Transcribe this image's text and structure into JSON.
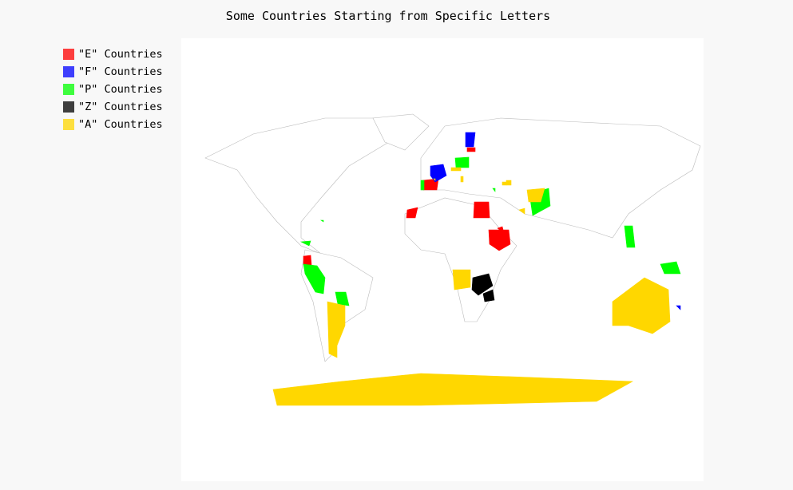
{
  "chart_data": {
    "type": "map",
    "title": "Some Countries Starting from Specific Letters",
    "legend_position": "top-left",
    "series": [
      {
        "name": "\"E\" Countries",
        "color": "#ff0000",
        "countries": [
          "ec",
          "ee",
          "eg",
          "eh",
          "er",
          "es",
          "et"
        ]
      },
      {
        "name": "\"F\" Countries",
        "color": "#0000ff",
        "countries": [
          "fi",
          "fr",
          "fj"
        ]
      },
      {
        "name": "\"P\" Countries",
        "color": "#00ff00",
        "countries": [
          "pa",
          "pe",
          "pg",
          "ph",
          "pk",
          "pl",
          "pr",
          "ps",
          "pt",
          "py"
        ]
      },
      {
        "name": "\"Z\" Countries",
        "color": "#000000",
        "countries": [
          "zm",
          "zw"
        ]
      },
      {
        "name": "\"A\" Countries",
        "color": "#ffd700",
        "countries": [
          "aq",
          "ar",
          "au",
          "ao",
          "af",
          "al",
          "am",
          "at",
          "az",
          "ae",
          "ad"
        ]
      }
    ]
  }
}
